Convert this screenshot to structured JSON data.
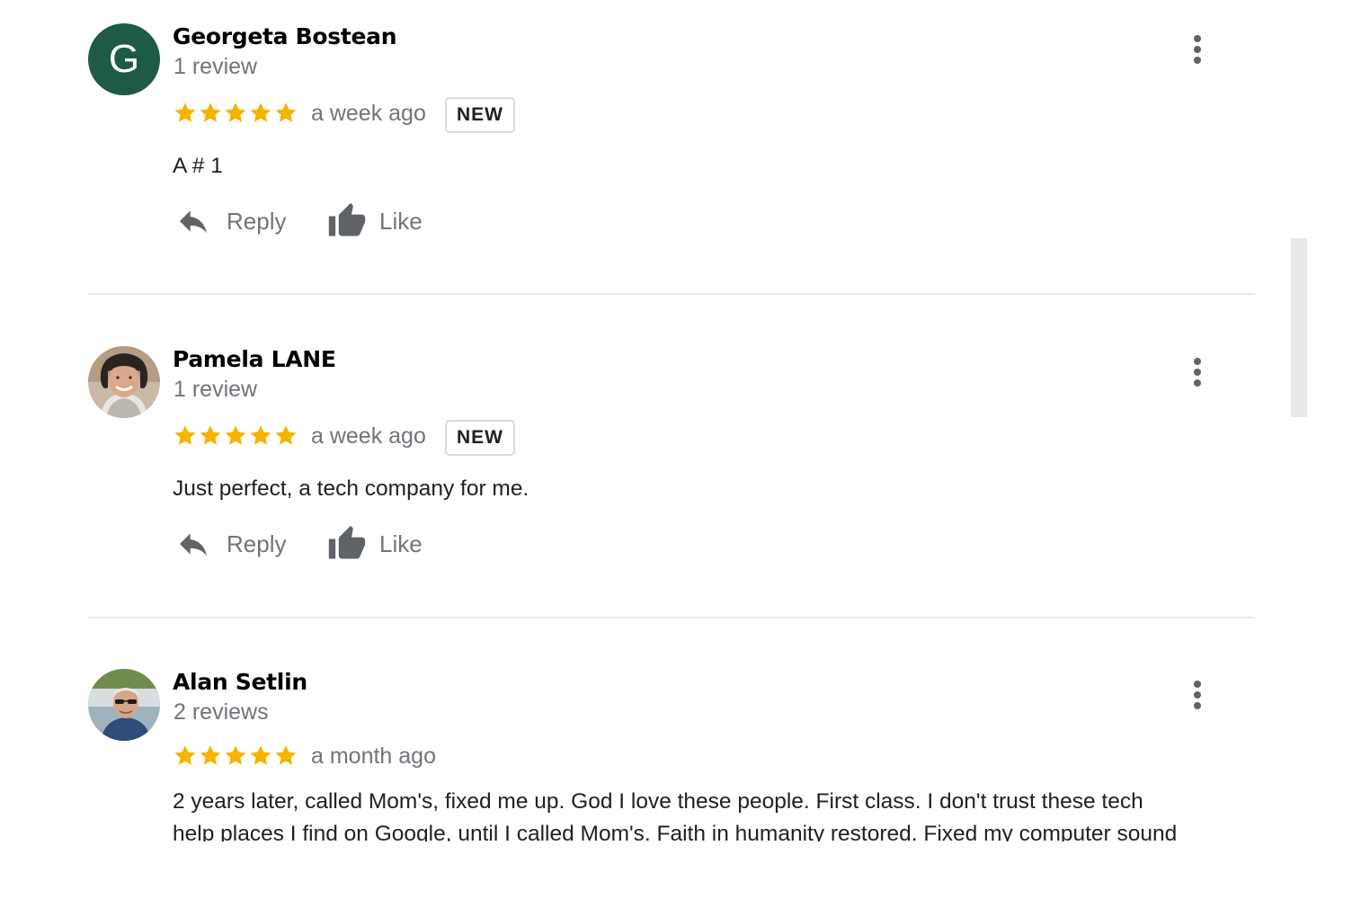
{
  "colors": {
    "star": "#f4b400",
    "secondary_text": "#70757a",
    "avatar_bg_g": "#1d5a48"
  },
  "reviews": [
    {
      "avatar_letter": "G",
      "name": "Georgeta Bostean",
      "review_count": "1 review",
      "rating": 5,
      "time": "a week ago",
      "badge": "NEW",
      "text": "A # 1",
      "reply_label": "Reply",
      "like_label": "Like"
    },
    {
      "avatar_letter": "",
      "name": "Pamela LANE",
      "review_count": "1 review",
      "rating": 5,
      "time": "a week ago",
      "badge": "NEW",
      "text": "Just perfect, a tech company for me.",
      "reply_label": "Reply",
      "like_label": "Like"
    },
    {
      "avatar_letter": "",
      "name": "Alan Setlin",
      "review_count": "2 reviews",
      "rating": 5,
      "time": "a month ago",
      "badge": "",
      "text_line1": "2 years later, called Mom's, fixed me up. God I love these people. First class. I  don't trust these tech",
      "text_line2": "help places I find on Google, until I called Mom's. Faith in humanity restored. Fixed my computer sound"
    }
  ]
}
